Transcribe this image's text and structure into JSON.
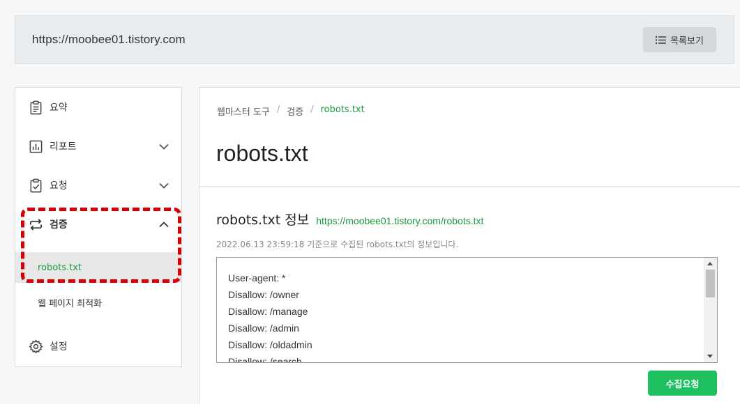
{
  "site": {
    "url": "https://moobee01.tistory.com",
    "list_button_label": "목록보기"
  },
  "sidebar": {
    "items": [
      {
        "label": "요약",
        "icon": "clipboard-icon"
      },
      {
        "label": "리포트",
        "icon": "bar-chart-icon"
      },
      {
        "label": "요청",
        "icon": "clipboard-check-icon"
      },
      {
        "label": "검증",
        "icon": "repeat-icon"
      },
      {
        "label": "설정",
        "icon": "gear-icon"
      }
    ],
    "sub_items": [
      {
        "label": "robots.txt",
        "active": true
      },
      {
        "label": "웹 페이지 최적화",
        "active": false
      }
    ]
  },
  "main": {
    "breadcrumb": [
      "웹마스터 도구",
      "검증",
      "robots.txt"
    ],
    "breadcrumb_sep": "/",
    "title": "robots.txt",
    "info_title": "robots.txt 정보",
    "info_link": "https://moobee01.tistory.com/robots.txt",
    "info_desc": "2022.06.13 23:59:18 기준으로 수집된 robots.txt의 정보입니다.",
    "robots_lines": [
      "User-agent: *",
      "Disallow: /owner",
      "Disallow: /manage",
      "Disallow: /admin",
      "Disallow: /oldadmin",
      "Disallow: /search"
    ],
    "collect_button_label": "수집요청"
  },
  "colors": {
    "accent_green": "#1a9a3c",
    "button_green": "#1ec15f",
    "highlight_red": "#d60000"
  }
}
